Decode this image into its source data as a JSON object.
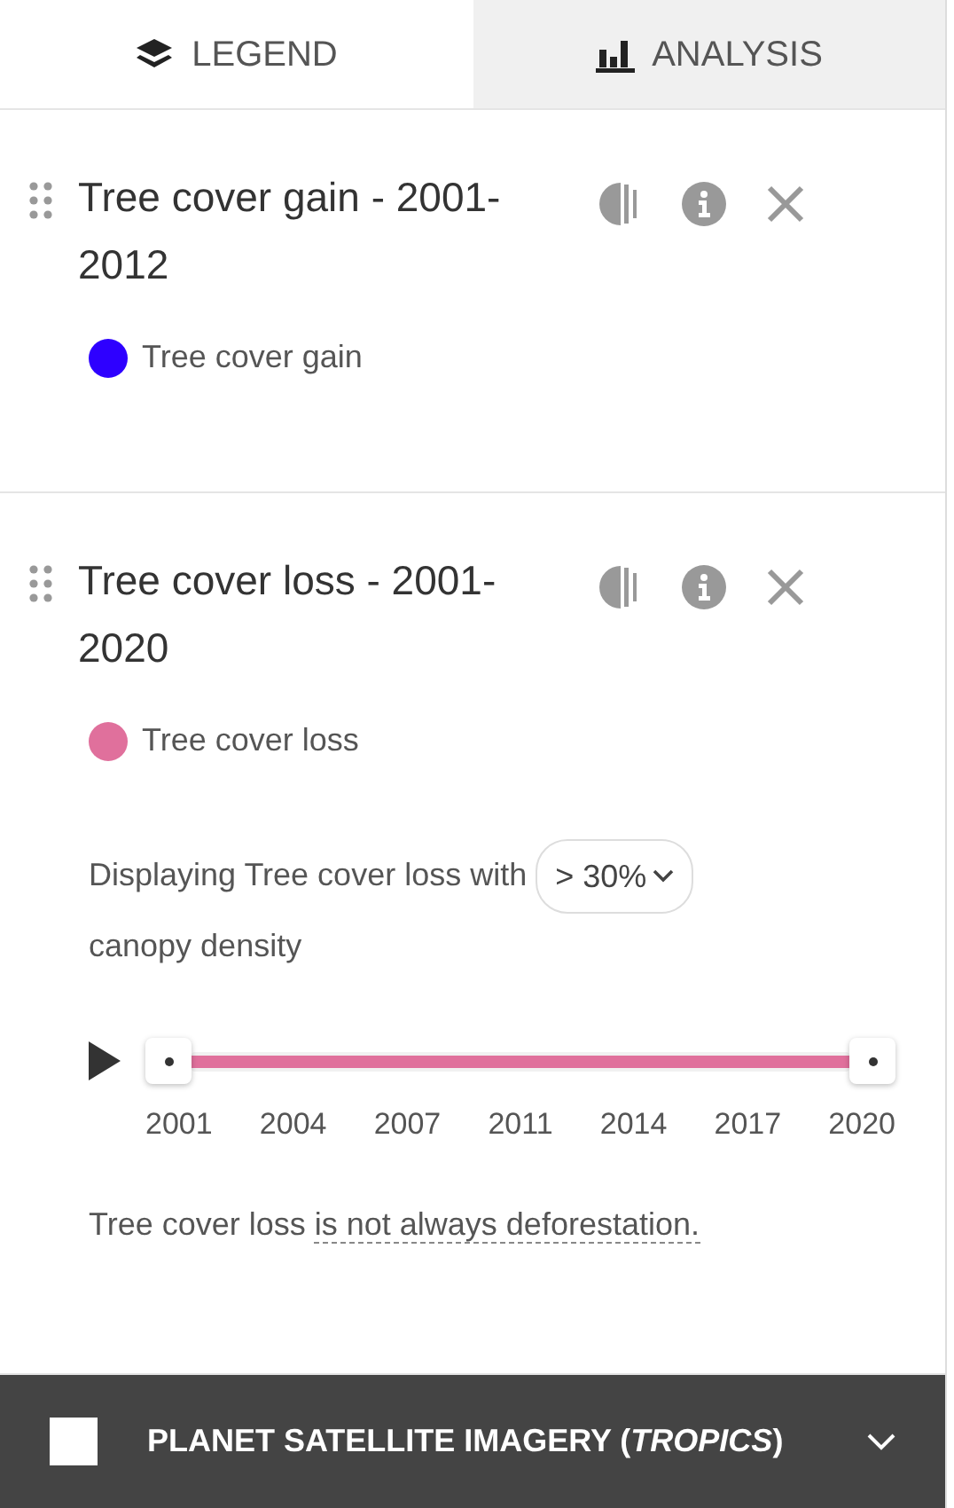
{
  "tabs": [
    {
      "label": "LEGEND",
      "kind": "legend",
      "selected": true
    },
    {
      "label": "ANALYSIS",
      "kind": "analysis",
      "selected": false
    }
  ],
  "layers": [
    {
      "title": "Tree cover gain - 2001-2012",
      "legend": [
        {
          "label": "Tree cover gain",
          "color": "#2e00ff"
        }
      ]
    },
    {
      "title": "Tree cover loss - 2001-2020",
      "legend": [
        {
          "label": "Tree cover loss",
          "color": "#e0709c"
        }
      ],
      "density": {
        "before": "Displaying Tree cover loss with",
        "value": "> 30%",
        "after": "canopy density"
      },
      "timeline": {
        "level": 1,
        "ticks": [
          "2001",
          "2004",
          "2007",
          "2011",
          "2014",
          "2017",
          "2020"
        ]
      },
      "note": {
        "text": "Tree cover loss",
        "link": "is not always deforestation."
      }
    }
  ],
  "basemap": {
    "title": "PLANET SATELLITE IMAGERY (*TROPICS*)",
    "checked": false
  }
}
